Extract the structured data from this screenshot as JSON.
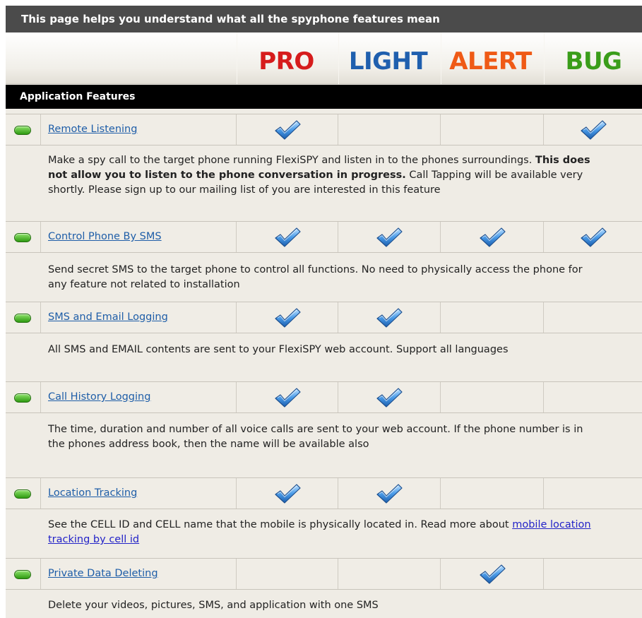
{
  "banner": {
    "title": "This page helps you understand what all the spyphone features mean"
  },
  "plans": [
    {
      "label": "PRO",
      "color": "#d61c1c"
    },
    {
      "label": "LIGHT",
      "color": "#1f5fae"
    },
    {
      "label": "ALERT",
      "color": "#ef5a16"
    },
    {
      "label": "BUG",
      "color": "#3a9d1a"
    }
  ],
  "section": {
    "title": "Application Features"
  },
  "features": [
    {
      "name": "Remote Listening",
      "checks": [
        true,
        false,
        false,
        true
      ],
      "desc_1": "Make a spy call to the target phone running FlexiSPY and listen in to the phones surroundings. ",
      "desc_bold": "This does not allow you to listen to the phone conversation in progress.",
      "desc_2": " Call Tapping will be available very shortly. Please sign up to our mailing list of you are interested in this feature"
    },
    {
      "name": "Control Phone By SMS",
      "checks": [
        true,
        true,
        true,
        true
      ],
      "desc": "Send secret SMS to the target phone to control all functions. No need to physically access the phone for any feature not related to installation"
    },
    {
      "name": "SMS and Email Logging ",
      "checks": [
        true,
        true,
        false,
        false
      ],
      "desc": "All SMS and EMAIL contents are sent to your FlexiSPY web account. Support all languages"
    },
    {
      "name": "Call History Logging",
      "checks": [
        true,
        true,
        false,
        false
      ],
      "desc": "The time, duration and number of all voice calls are sent to your web account. If the phone number is in the phones address book, then the name will be available also"
    },
    {
      "name": "Location Tracking ",
      "checks": [
        true,
        true,
        false,
        false
      ],
      "desc": "See the CELL ID and CELL name that the mobile is physically located in. Read more about ",
      "desc_link": "mobile location tracking by cell id"
    },
    {
      "name": "Private Data Deleting",
      "checks": [
        false,
        false,
        true,
        false
      ],
      "desc": "Delete your videos, pictures, SMS, and application with one SMS"
    }
  ],
  "icons": {
    "bullet": "green-pill-icon",
    "check": "blue-checkmark-icon"
  }
}
